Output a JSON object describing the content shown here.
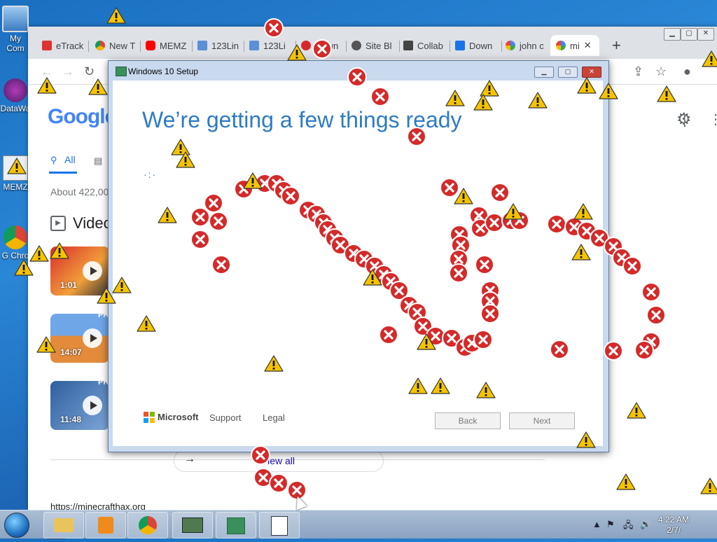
{
  "desktop": {
    "icons": [
      {
        "label": "My Com"
      },
      {
        "label": "DataWa"
      },
      {
        "label": "MEMZ"
      },
      {
        "label": "G Chro"
      }
    ]
  },
  "browser": {
    "tabs": [
      {
        "label": "eTrack",
        "icon": "etrack-favicon"
      },
      {
        "label": "New T",
        "icon": "chrome-favicon"
      },
      {
        "label": "MEMZ",
        "icon": "youtube-favicon"
      },
      {
        "label": "123Lin",
        "icon": "123link-favicon"
      },
      {
        "label": "123Li",
        "icon": "123link-favicon"
      },
      {
        "label": "Down",
        "icon": "mega-favicon"
      },
      {
        "label": "Site Bl",
        "icon": "globe-favicon"
      },
      {
        "label": "Collab",
        "icon": "colab-favicon"
      },
      {
        "label": "Down",
        "icon": "download-favicon"
      },
      {
        "label": "john c",
        "icon": "google-favicon"
      },
      {
        "label": "mi",
        "icon": "google-favicon"
      }
    ],
    "new_tab_label": "+",
    "google_logo": "Google",
    "search_tabs": {
      "all": "All"
    },
    "results_count": "About 422,00",
    "videos_heading": "Video",
    "videos": [
      {
        "duration": "1:01",
        "badge": "PR"
      },
      {
        "duration": "14:07",
        "badge": "PR"
      },
      {
        "duration": "11:48",
        "badge": "PR"
      }
    ],
    "view_all": "View all",
    "result_url": "https://minecrafthax.org"
  },
  "setup": {
    "window_title": "Windows 10 Setup",
    "headline": "We’re getting a few things ready",
    "brand": "Microsoft",
    "support": "Support",
    "legal": "Legal",
    "back": "Back",
    "next": "Next"
  },
  "taskbar": {
    "time": "4:22 AM",
    "date": "2/7/"
  },
  "colors": {
    "accent": "#2d7bc4",
    "error_red": "#d42a2a",
    "warning_yellow": "#f5c400"
  }
}
